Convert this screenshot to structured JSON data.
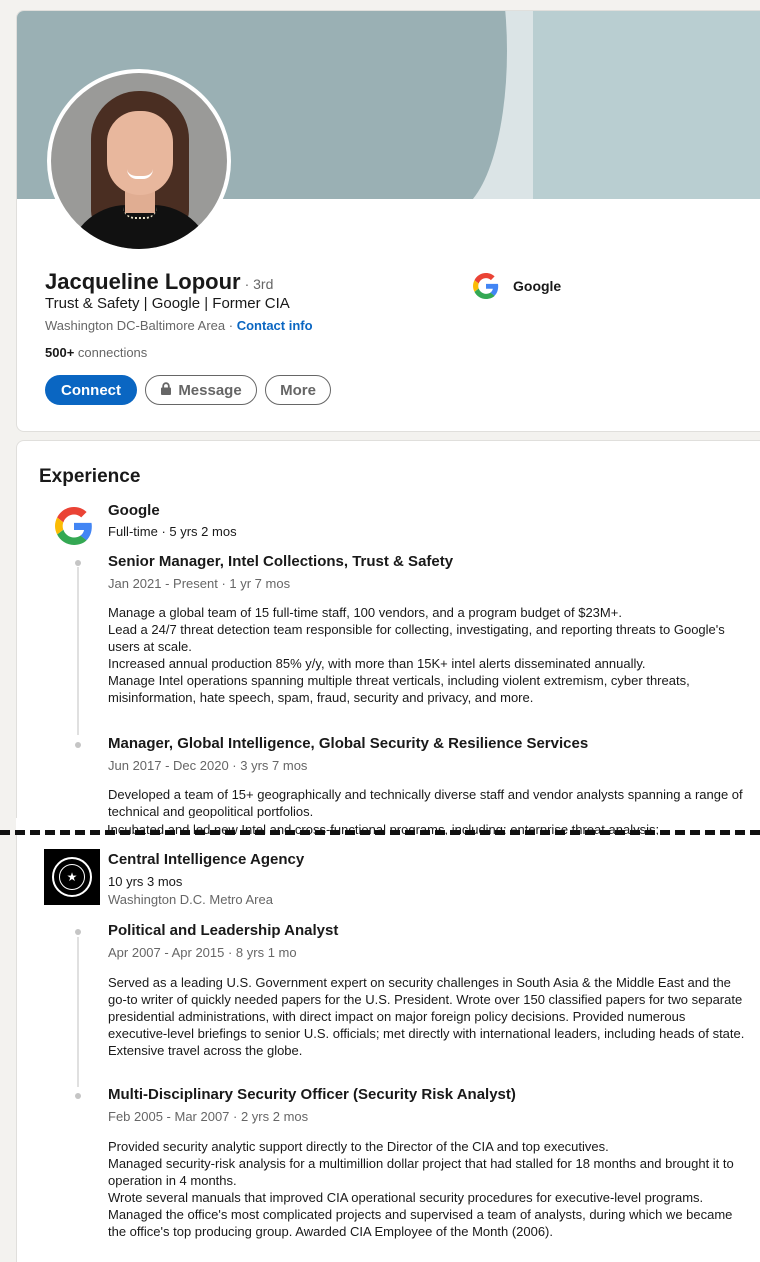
{
  "profile": {
    "name": "Jacqueline Lopour",
    "degree": "· 3rd",
    "headline": "Trust & Safety | Google | Former CIA",
    "location": "Washington DC-Baltimore Area ·",
    "contact_info": "Contact info",
    "connections_count": "500+",
    "connections_label": " connections",
    "current_company": "Google",
    "buttons": {
      "connect": "Connect",
      "message": "Message",
      "more": "More"
    }
  },
  "experience": {
    "title": "Experience",
    "companies": [
      {
        "name": "Google",
        "sub": "Full-time · 5 yrs 2 mos",
        "roles": [
          {
            "title": "Senior Manager, Intel Collections, Trust & Safety",
            "dates": "Jan 2021 - Present · 1 yr 7 mos",
            "desc": [
              "Manage a global team of 15 full-time staff, 100 vendors, and a program budget of $23M+.",
              "Lead a 24/7 threat detection team responsible for collecting, investigating, and reporting threats to Google's users at scale.",
              "Increased annual production 85% y/y, with more than 15K+ intel alerts disseminated annually.",
              "Manage Intel operations spanning multiple threat verticals, including violent extremism, cyber threats, misinformation, hate speech, spam, fraud, security and privacy, and more."
            ]
          },
          {
            "title": "Manager, Global Intelligence, Global Security & Resilience Services",
            "dates": "Jun 2017 - Dec 2020 · 3 yrs 7 mos",
            "desc": [
              "Developed a team of 15+ geographically and technically diverse staff and vendor analysts spanning a range of technical and geopolitical portfolios."
            ],
            "cut_line": "Incubated and led new Intel and cross-functional programs, including: enterprise threat analysis;"
          }
        ]
      },
      {
        "name": "Central Intelligence Agency",
        "sub": "10 yrs 3 mos",
        "sub2": "Washington D.C. Metro Area",
        "roles": [
          {
            "title": "Political and Leadership Analyst",
            "dates": "Apr 2007 - Apr 2015 · 8 yrs 1 mo",
            "desc": [
              "Served as a leading U.S. Government expert on security challenges in South Asia & the Middle East and the go-to writer of quickly needed papers for the U.S. President. Wrote over 150 classified papers for two separate presidential administrations, with direct impact on major foreign policy decisions. Provided numerous executive-level briefings to senior U.S. officials; met directly with international leaders, including heads of state. Extensive travel across the globe."
            ]
          },
          {
            "title": "Multi-Disciplinary Security Officer (Security Risk Analyst)",
            "dates": "Feb 2005 - Mar 2007 · 2 yrs 2 mos",
            "desc": [
              "Provided security analytic support directly to the Director of the CIA and top executives.",
              "Managed security-risk analysis for a multimillion dollar project that had stalled for 18 months and brought it to operation in 4 months.",
              "Wrote several manuals that improved CIA operational security procedures for executive-level programs.",
              "Managed the office's most complicated projects and supervised a team of analysts, during which we became the office's top producing group. Awarded CIA Employee of the Month (2006)."
            ]
          }
        ]
      }
    ]
  },
  "colors": {
    "primary": "#0a66c2",
    "banner": "#9ab0b4",
    "text_muted": "#666666"
  },
  "icons": [
    "google-logo-icon",
    "lock-icon",
    "cia-seal-icon"
  ]
}
